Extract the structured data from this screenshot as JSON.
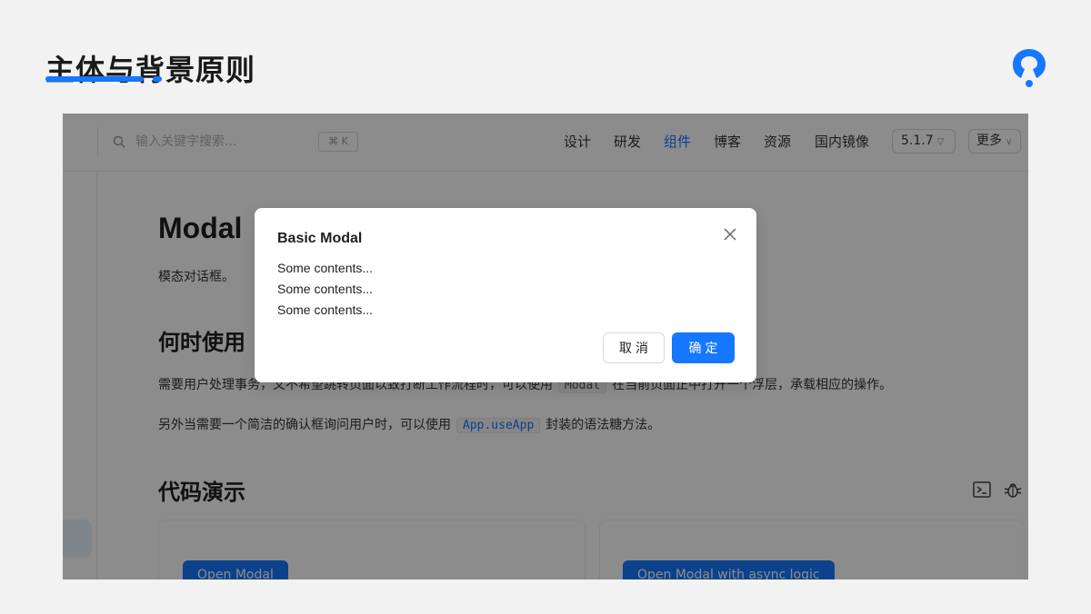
{
  "slide": {
    "title": "主体与背景原则",
    "accent_color": "#1677ff",
    "logo_icon": "pin-logo-icon"
  },
  "header": {
    "search": {
      "placeholder": "输入关键字搜索...",
      "shortcut": "⌘ K",
      "icon": "search-icon"
    },
    "nav": [
      {
        "label": "设计",
        "active": false
      },
      {
        "label": "研发",
        "active": false
      },
      {
        "label": "组件",
        "active": true
      },
      {
        "label": "博客",
        "active": false
      },
      {
        "label": "资源",
        "active": false
      },
      {
        "label": "国内镜像",
        "active": false
      }
    ],
    "version": "5.1.7",
    "more": "更多"
  },
  "page": {
    "title": "Modal",
    "subtitle": "模态对话框。",
    "when_to_use": {
      "heading": "何时使用",
      "para1_a": "需要用户处理事务，又不希望跳转页面以致打断工作流程时，可以使用",
      "para1_code": "Modal",
      "para1_b": "在当前页面正中打开一个浮层，承载相应的操作。",
      "para2_a": "另外当需要一个简洁的确认框询问用户时，可以使用",
      "para2_code": "App.useApp",
      "para2_b": "封装的语法糖方法。"
    },
    "demo": {
      "heading": "代码演示",
      "icons": [
        "terminal-icon",
        "bug-icon"
      ],
      "buttons": [
        "Open Modal",
        "Open Modal with async logic"
      ]
    }
  },
  "modal": {
    "title": "Basic Modal",
    "lines": [
      "Some contents...",
      "Some contents...",
      "Some contents..."
    ],
    "cancel": "取消",
    "ok": "确定",
    "close_icon": "close-icon"
  }
}
